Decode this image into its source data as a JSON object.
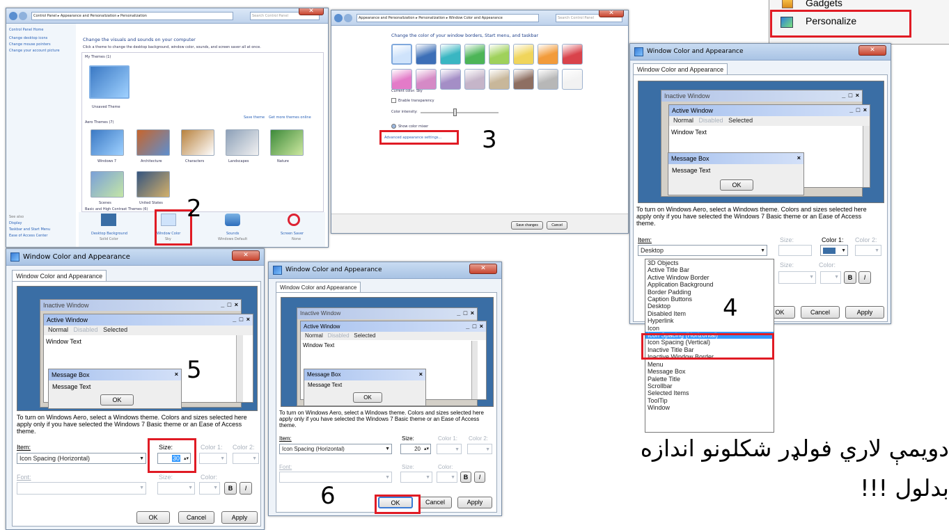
{
  "context_menu": {
    "items": [
      {
        "label": "Gadgets",
        "icon": "gadgets-icon"
      },
      {
        "label": "Personalize",
        "icon": "personalize-icon"
      }
    ]
  },
  "personalization": {
    "breadcrumb": "Control Panel ▸ Appearance and Personalization ▸ Personalization",
    "search_placeholder": "Search Control Panel",
    "side_links": [
      "Control Panel Home",
      "Change desktop icons",
      "Change mouse pointers",
      "Change your account picture"
    ],
    "see_also": "See also",
    "see_also_links": [
      "Display",
      "Taskbar and Start Menu",
      "Ease of Access Center"
    ],
    "heading": "Change the visuals and sounds on your computer",
    "subheading": "Click a theme to change the desktop background, window color, sounds, and screen saver all at once.",
    "my_themes": "My Themes (1)",
    "unsaved_theme": "Unsaved Theme",
    "save_theme": "Save theme",
    "get_more": "Get more themes online",
    "aero_themes": "Aero Themes (7)",
    "themes": [
      "Windows 7",
      "Architecture",
      "Characters",
      "Landscapes",
      "Nature",
      "Scenes",
      "United States"
    ],
    "basic_themes": "Basic and High Contrast Themes (6)",
    "bottom": [
      {
        "title": "Desktop Background",
        "sub": "Solid Color"
      },
      {
        "title": "Window Color",
        "sub": "Sky"
      },
      {
        "title": "Sounds",
        "sub": "Windows Default"
      },
      {
        "title": "Screen Saver",
        "sub": "None"
      }
    ]
  },
  "color_window": {
    "breadcrumb": "Appearance and Personalization ▸ Personalization ▸ Window Color and Appearance",
    "search_placeholder": "Search Control Panel",
    "heading": "Change the color of your window borders, Start menu, and taskbar",
    "swatch_colors": [
      "#cfe3fb",
      "#3d6fb7",
      "#39b6c2",
      "#4db557",
      "#9fd15b",
      "#f0d55b",
      "#f29b3b",
      "#d9434b",
      "#e37bc8",
      "#d58ac6",
      "#a48ec6",
      "#c5b5c9",
      "#c8b79a",
      "#8e6f62",
      "#b7b7b7",
      "#f2f2f2"
    ],
    "current_color": "Current color: Sky",
    "enable_transparency": "Enable transparency",
    "color_intensity": "Color intensity:",
    "show_color_mixer": "Show color mixer",
    "advanced_link": "Advanced appearance settings...",
    "save": "Save changes",
    "cancel": "Cancel"
  },
  "dialog": {
    "title": "Window Color and Appearance",
    "tab": "Window Color and Appearance",
    "inactive": "Inactive Window",
    "active": "Active Window",
    "controls": "_ □ ×",
    "menu_normal": "Normal",
    "menu_disabled": "Disabled",
    "menu_selected": "Selected",
    "window_text": "Window Text",
    "message_box": "Message Box",
    "message_text": "Message Text",
    "ok": "OK",
    "info": "To turn on Windows Aero, select a Windows theme.  Colors and sizes selected here apply only if you have selected the Windows 7 Basic theme or an Ease of Access theme.",
    "item_label": "Item:",
    "size_label": "Size:",
    "color1": "Color 1:",
    "color2": "Color 2:",
    "font_label": "Font:",
    "color_label": "Color:",
    "bold": "B",
    "italic": "I",
    "cancel": "Cancel",
    "apply": "Apply"
  },
  "dialog4": {
    "item_value": "Desktop",
    "list": [
      "3D Objects",
      "Active Title Bar",
      "Active Window Border",
      "Application Background",
      "Border Padding",
      "Caption Buttons",
      "Desktop",
      "Disabled Item",
      "Hyperlink",
      "Icon",
      "Icon Spacing (Horizontal)",
      "Icon Spacing (Vertical)",
      "Inactive Title Bar",
      "Inactive Window Border",
      "Menu",
      "Message Box",
      "Palette Title",
      "Scrollbar",
      "Selected Items",
      "ToolTip",
      "Window"
    ],
    "selected": "Icon Spacing (Horizontal)"
  },
  "dialog5": {
    "item_value": "Icon Spacing (Horizontal)",
    "size_value": "30"
  },
  "dialog6": {
    "item_value": "Icon Spacing (Horizontal)",
    "size_value": "20"
  },
  "steps": [
    "2",
    "3",
    "4",
    "5",
    "6"
  ],
  "caption": {
    "line1": "دويمې لاري فولډر شکلونو اندازه",
    "line2": "بدلول !!!"
  }
}
